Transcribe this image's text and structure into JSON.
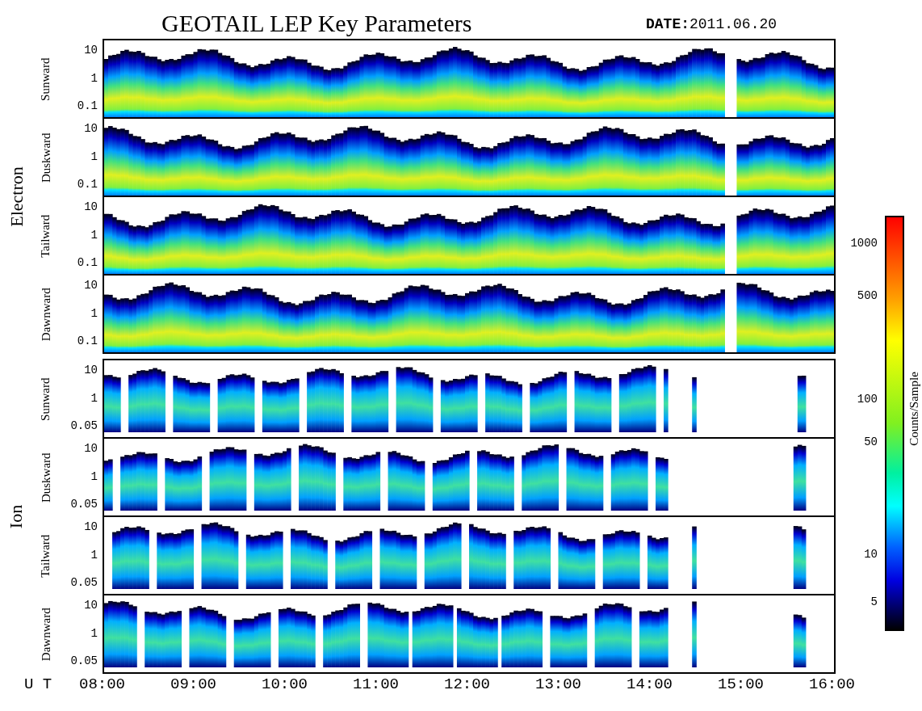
{
  "title": "GEOTAIL LEP Key Parameters",
  "date": {
    "label": "DATE:",
    "value": "2011.06.20"
  },
  "groups": [
    {
      "kind": "electron",
      "name": "Electron",
      "panels": [
        {
          "direction": "Sunward",
          "yticks": [
            "10",
            "1",
            "0.1"
          ]
        },
        {
          "direction": "Duskward",
          "yticks": [
            "10",
            "1",
            "0.1"
          ]
        },
        {
          "direction": "Tailward",
          "yticks": [
            "10",
            "1",
            "0.1"
          ]
        },
        {
          "direction": "Dawnward",
          "yticks": [
            "10",
            "1",
            "0.1"
          ]
        }
      ]
    },
    {
      "kind": "ion",
      "name": "Ion",
      "panels": [
        {
          "direction": "Sunward",
          "yticks": [
            "10",
            "1",
            "0.05"
          ]
        },
        {
          "direction": "Duskward",
          "yticks": [
            "10",
            "1",
            "0.05"
          ]
        },
        {
          "direction": "Tailward",
          "yticks": [
            "10",
            "1",
            "0.05"
          ]
        },
        {
          "direction": "Dawnward",
          "yticks": [
            "10",
            "1",
            "0.05"
          ]
        }
      ]
    }
  ],
  "x_axis": {
    "label": "U T",
    "ticks": [
      "08:00",
      "09:00",
      "10:00",
      "11:00",
      "12:00",
      "13:00",
      "14:00",
      "15:00",
      "16:00"
    ]
  },
  "colorbar": {
    "title": "Counts/Sample",
    "ticks": [
      "1000",
      "500",
      "100",
      "50",
      "10",
      "5"
    ]
  }
}
